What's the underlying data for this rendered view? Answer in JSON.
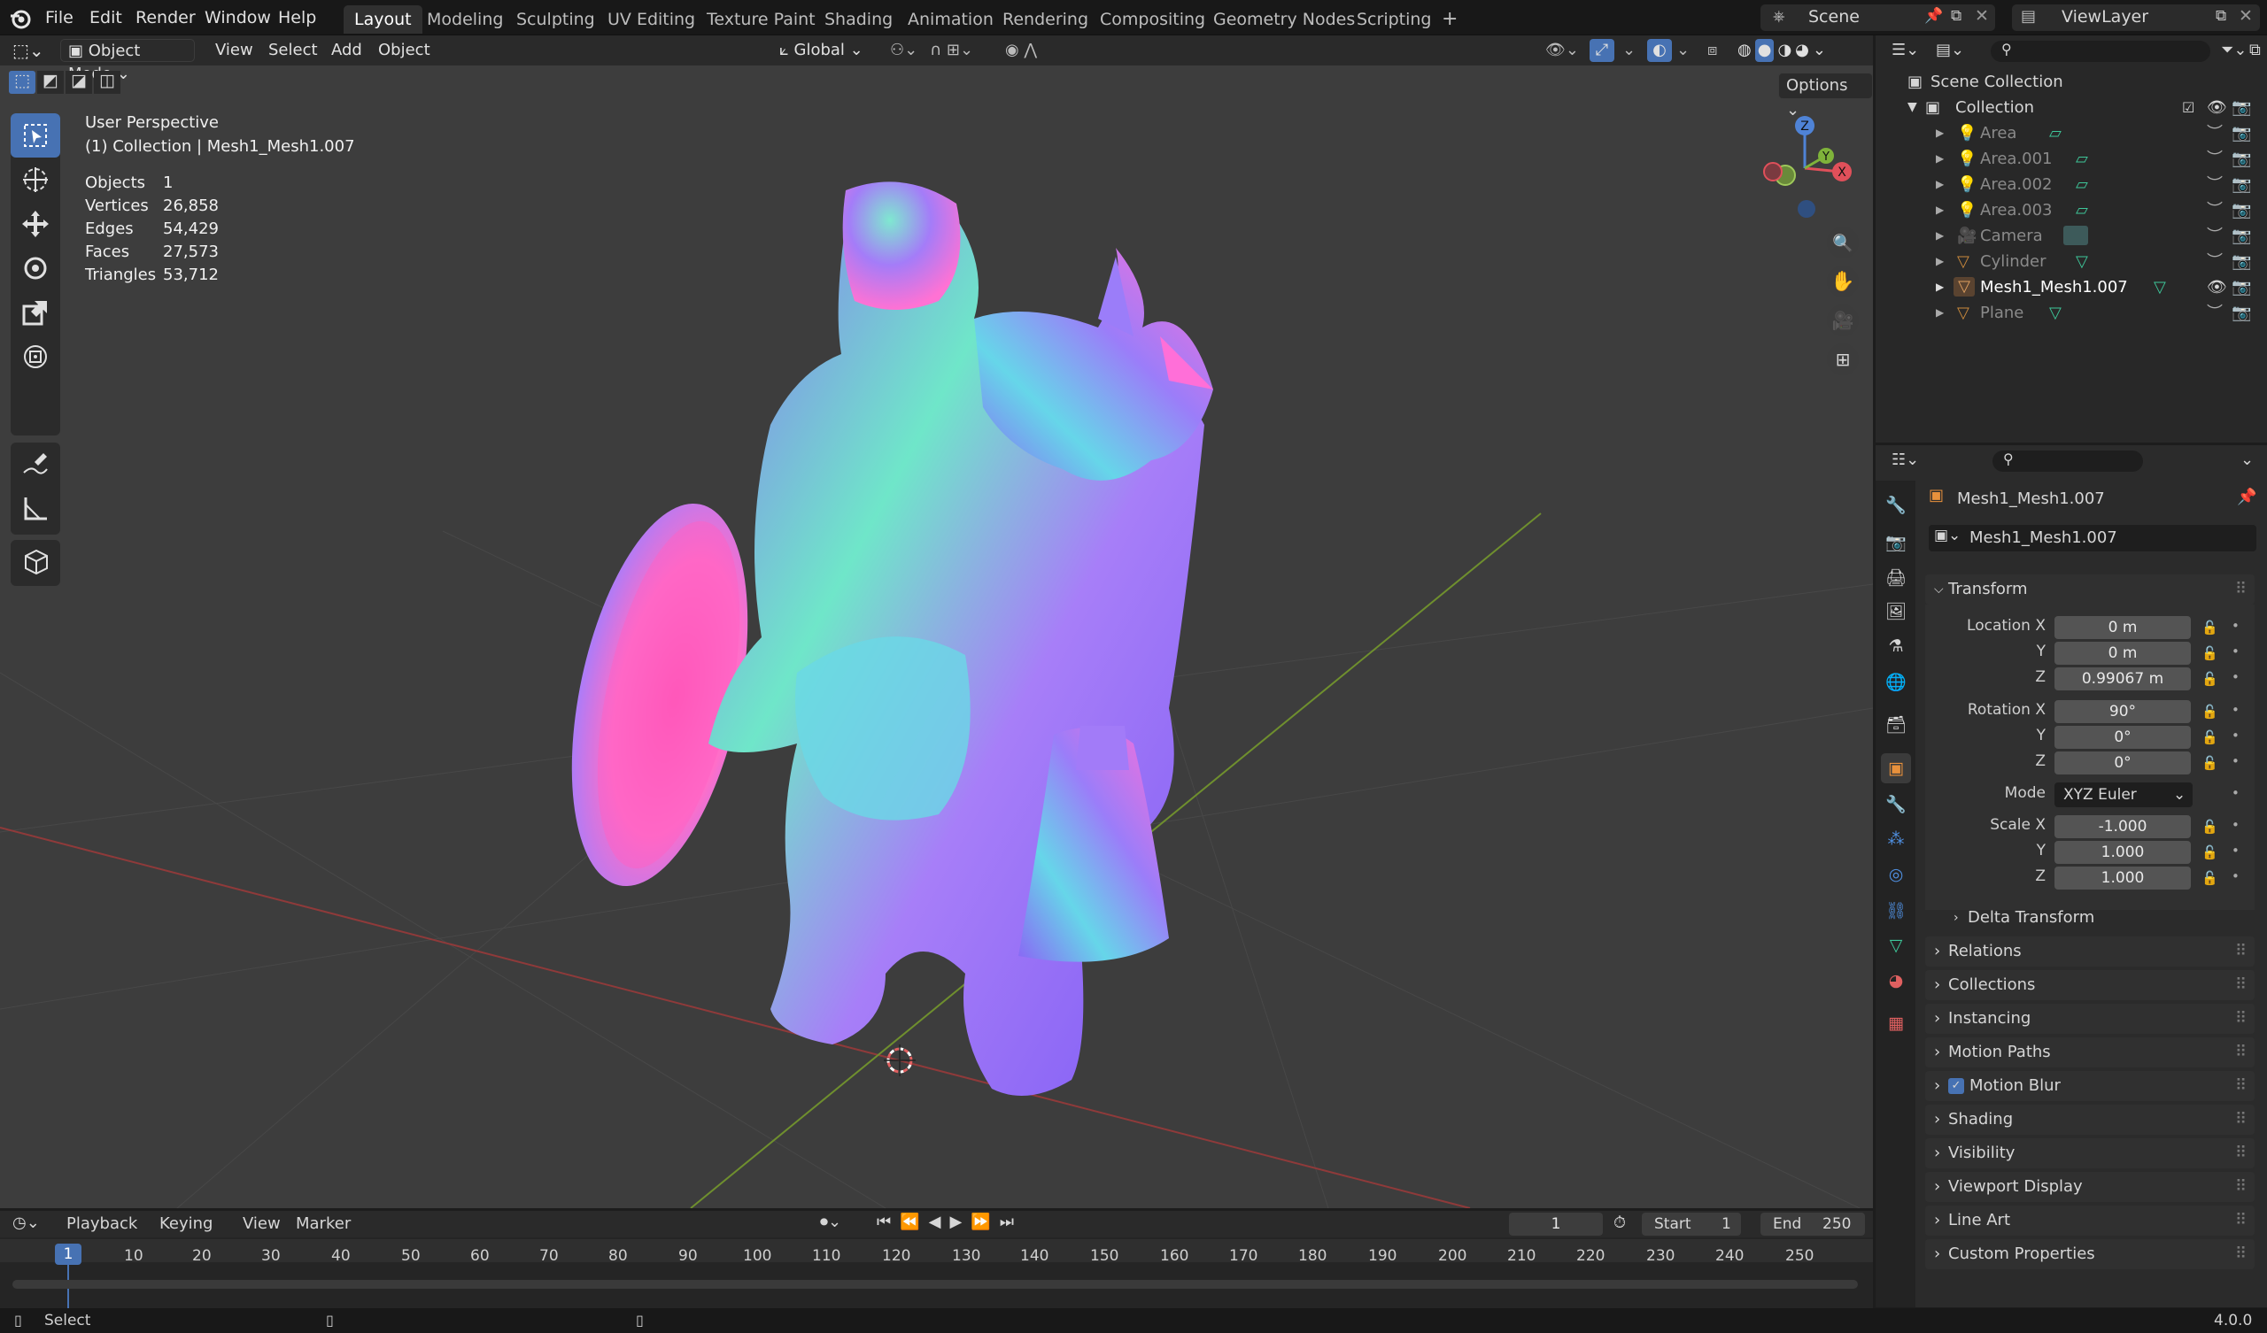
{
  "menubar": {
    "items": [
      "File",
      "Edit",
      "Render",
      "Window",
      "Help"
    ],
    "workspaces": [
      "Layout",
      "Modeling",
      "Sculpting",
      "UV Editing",
      "Texture Paint",
      "Shading",
      "Animation",
      "Rendering",
      "Compositing",
      "Geometry Nodes",
      "Scripting"
    ],
    "active_workspace": "Layout",
    "add_tab": "+",
    "scene": "Scene",
    "view_layer": "ViewLayer"
  },
  "viewport": {
    "mode": "Object Mode",
    "menus": [
      "View",
      "Select",
      "Add",
      "Object"
    ],
    "orientation": "Global",
    "options": "Options",
    "perspective": "User Perspective",
    "collection_info": "(1) Collection | Mesh1_Mesh1.007",
    "stats": [
      {
        "label": "Objects",
        "value": "1"
      },
      {
        "label": "Vertices",
        "value": "26,858"
      },
      {
        "label": "Edges",
        "value": "54,429"
      },
      {
        "label": "Faces",
        "value": "27,573"
      },
      {
        "label": "Triangles",
        "value": "53,712"
      }
    ],
    "gizmo": {
      "z": "Z",
      "y": "Y",
      "x": "X"
    }
  },
  "outliner": {
    "scene_collection": "Scene Collection",
    "collection": "Collection",
    "items": [
      "Area",
      "Area.001",
      "Area.002",
      "Area.003",
      "Camera",
      "Cylinder",
      "Mesh1_Mesh1.007",
      "Plane"
    ],
    "selected": "Mesh1_Mesh1.007"
  },
  "properties": {
    "object_name": "Mesh1_Mesh1.007",
    "data_name": "Mesh1_Mesh1.007",
    "transform": {
      "title": "Transform",
      "location_label": "Location X",
      "rotation_label": "Rotation X",
      "scale_label": "Scale X",
      "y": "Y",
      "z": "Z",
      "location": [
        "0 m",
        "0 m",
        "0.99067 m"
      ],
      "rotation": [
        "90°",
        "0°",
        "0°"
      ],
      "mode_label": "Mode",
      "mode": "XYZ Euler",
      "scale": [
        "-1.000",
        "1.000",
        "1.000"
      ],
      "delta": "Delta Transform"
    },
    "panels": [
      "Relations",
      "Collections",
      "Instancing",
      "Motion Paths",
      "Motion Blur",
      "Shading",
      "Visibility",
      "Viewport Display",
      "Line Art",
      "Custom Properties"
    ]
  },
  "timeline": {
    "menus": [
      "Playback",
      "Keying",
      "View",
      "Marker"
    ],
    "current_frame": "1",
    "start_label": "Start",
    "start": "1",
    "end_label": "End",
    "end": "250",
    "ticks": [
      "1",
      "10",
      "20",
      "30",
      "40",
      "50",
      "60",
      "70",
      "80",
      "90",
      "100",
      "110",
      "120",
      "130",
      "140",
      "150",
      "160",
      "170",
      "180",
      "190",
      "200",
      "210",
      "220",
      "230",
      "240",
      "250"
    ]
  },
  "statusbar": {
    "left": "Select",
    "version": "4.0.0"
  }
}
